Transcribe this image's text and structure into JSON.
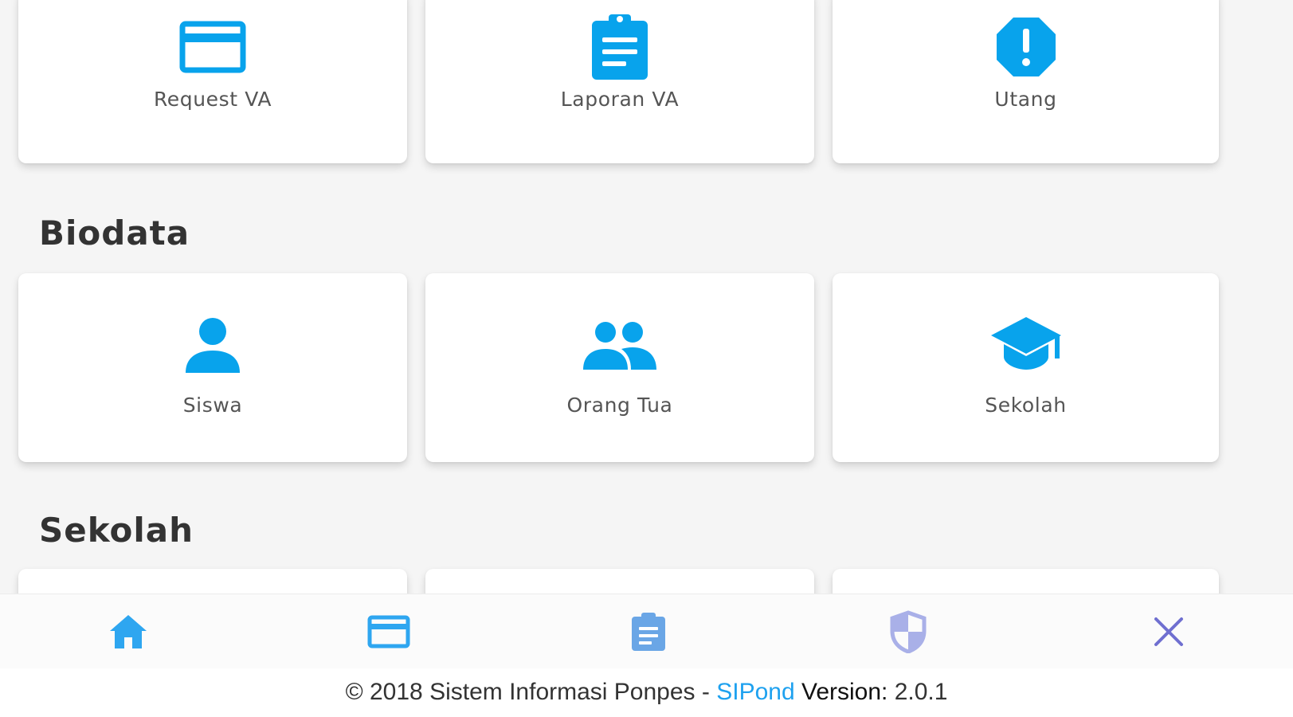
{
  "colors": {
    "accent": "#08a3ec",
    "page_background": "#f5f5f5",
    "nav_home": "#2ea6f0",
    "nav_card": "#2ea6f0",
    "nav_clipboard": "#6aa6e6",
    "nav_shield": "#a9b0e8",
    "nav_close": "#6f6fd0",
    "brand_text": "#1ea1ef"
  },
  "payment_menu": {
    "items": [
      {
        "label": "Request VA",
        "icon": "credit-card-icon"
      },
      {
        "label": "Laporan VA",
        "icon": "clipboard-list-icon"
      },
      {
        "label": "Utang",
        "icon": "alert-octagon-icon"
      }
    ]
  },
  "sections": {
    "biodata": {
      "title": "Biodata",
      "items": [
        {
          "label": "Siswa",
          "icon": "person-icon"
        },
        {
          "label": "Orang Tua",
          "icon": "people-icon"
        },
        {
          "label": "Sekolah",
          "icon": "graduation-cap-icon"
        }
      ]
    },
    "sekolah": {
      "title": "Sekolah"
    }
  },
  "bottom_nav": {
    "items": [
      {
        "icon": "home-icon"
      },
      {
        "icon": "credit-card-icon"
      },
      {
        "icon": "clipboard-list-icon"
      },
      {
        "icon": "shield-icon"
      },
      {
        "icon": "close-icon"
      }
    ]
  },
  "footer": {
    "copyright": "© 2018 Sistem Informasi Ponpes - ",
    "brand": "SIPond",
    "version_label": " Version:",
    "version": " 2.0.1"
  }
}
